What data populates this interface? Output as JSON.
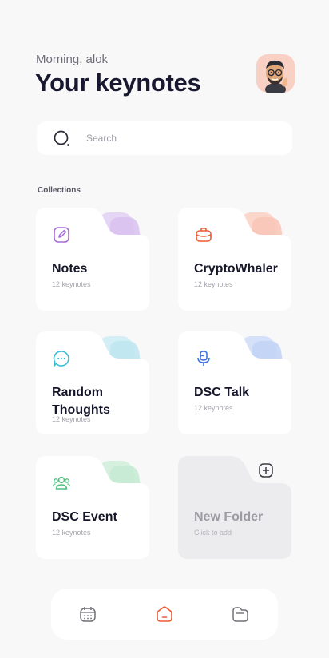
{
  "header": {
    "greeting": "Morning, alok",
    "title": "Your keynotes",
    "avatar_icon": "memoji-avatar"
  },
  "search": {
    "placeholder": "Search",
    "value": "",
    "icon": "search-icon"
  },
  "collections": {
    "heading": "Collections",
    "items": [
      {
        "name": "Notes",
        "count": "12 keynotes",
        "icon": "edit-icon",
        "color": "#a66bd8",
        "accent": "#d9c3f0"
      },
      {
        "name": "CryptoWhaler",
        "count": "12 keynotes",
        "icon": "briefcase-icon",
        "color": "#ef5a36",
        "accent": "#f9c6b8"
      },
      {
        "name": "Random Thoughts",
        "count": "12 keynotes",
        "icon": "chat-icon",
        "color": "#3bbfd6",
        "accent": "#bfe6ef"
      },
      {
        "name": "DSC Talk",
        "count": "12 keynotes",
        "icon": "microphone-icon",
        "color": "#3d74e6",
        "accent": "#c2d4f5"
      },
      {
        "name": "DSC Event",
        "count": "12 keynotes",
        "icon": "users-icon",
        "color": "#4ec07f",
        "accent": "#c5ead3"
      }
    ],
    "new_folder": {
      "name": "New Folder",
      "hint": "Click to add",
      "icon": "plus-icon"
    }
  },
  "nav": {
    "items": [
      {
        "icon": "calendar-icon",
        "active": false
      },
      {
        "icon": "home-icon",
        "active": true,
        "color": "#ef5a36"
      },
      {
        "icon": "folder-icon",
        "active": false
      }
    ]
  }
}
